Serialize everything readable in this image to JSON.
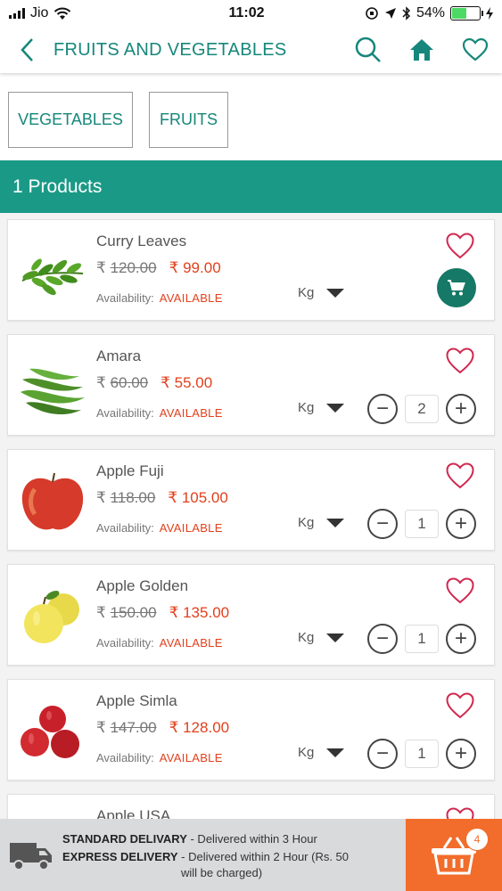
{
  "status_bar": {
    "carrier": "Jio",
    "time": "11:02",
    "battery": "54%",
    "battery_level": 0.54
  },
  "header": {
    "title": "FRUITS AND VEGETABLES",
    "icons": [
      "back-icon",
      "search-icon",
      "home-icon",
      "heart-icon"
    ],
    "accent_color": "#16877a"
  },
  "categories": [
    "VEGETABLES",
    "FRUITS"
  ],
  "products_count_label": "1 Products",
  "currency_symbol": "₹",
  "availability_label": "Availability:",
  "products": [
    {
      "name": "Curry Leaves",
      "old_price": "120.00",
      "new_price": "₹ 99.00",
      "availability": "AVAILABLE",
      "unit": "Kg",
      "in_cart": false
    },
    {
      "name": "Amara",
      "old_price": "60.00",
      "new_price": "₹ 55.00",
      "availability": "AVAILABLE",
      "unit": "Kg",
      "in_cart": true,
      "qty": "2"
    },
    {
      "name": "Apple Fuji",
      "old_price": "118.00",
      "new_price": "₹ 105.00",
      "availability": "AVAILABLE",
      "unit": "Kg",
      "in_cart": true,
      "qty": "1"
    },
    {
      "name": "Apple Golden",
      "old_price": "150.00",
      "new_price": "₹ 135.00",
      "availability": "AVAILABLE",
      "unit": "Kg",
      "in_cart": true,
      "qty": "1"
    },
    {
      "name": "Apple Simla",
      "old_price": "147.00",
      "new_price": "₹ 128.00",
      "availability": "AVAILABLE",
      "unit": "Kg",
      "in_cart": true,
      "qty": "1"
    },
    {
      "name": "Apple USA"
    }
  ],
  "delivery": {
    "standard_label": "STANDARD DELIVARY",
    "standard_text": " - Delivered within 3 Hour",
    "express_label": "EXPRESS DELIVERY",
    "express_text": " - Delivered within 2  Hour (Rs. 50",
    "express_text_2": "will be charged)"
  },
  "cart": {
    "count": "4",
    "color": "#f26c2b"
  }
}
